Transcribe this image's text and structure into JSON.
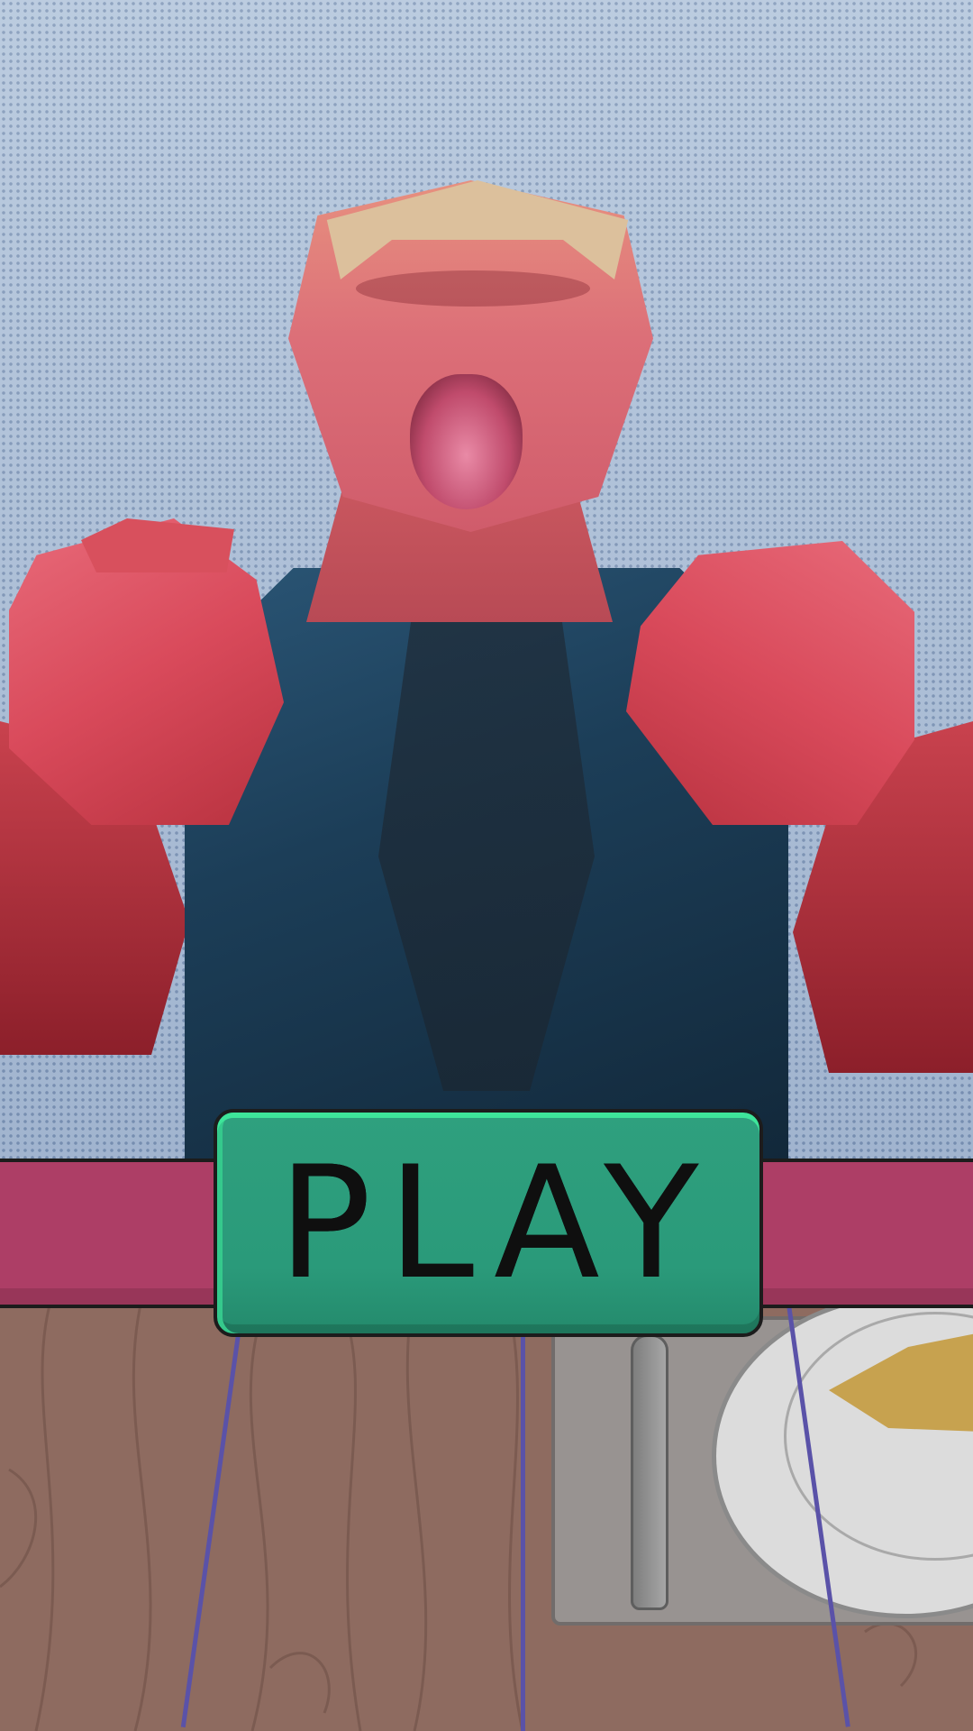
{
  "scene": {
    "name": "title-screen",
    "character": "angry-lowpoly-man",
    "props": [
      "wooden-table",
      "placemat",
      "knife",
      "plate",
      "cheese"
    ]
  },
  "play_button": {
    "label": "PLAY"
  },
  "colors": {
    "button": "#2a9a7a",
    "button_highlight": "#3ee59a",
    "bar": "#ad3e66",
    "table": "#8e6b60",
    "wall": "#b4c6dc"
  }
}
